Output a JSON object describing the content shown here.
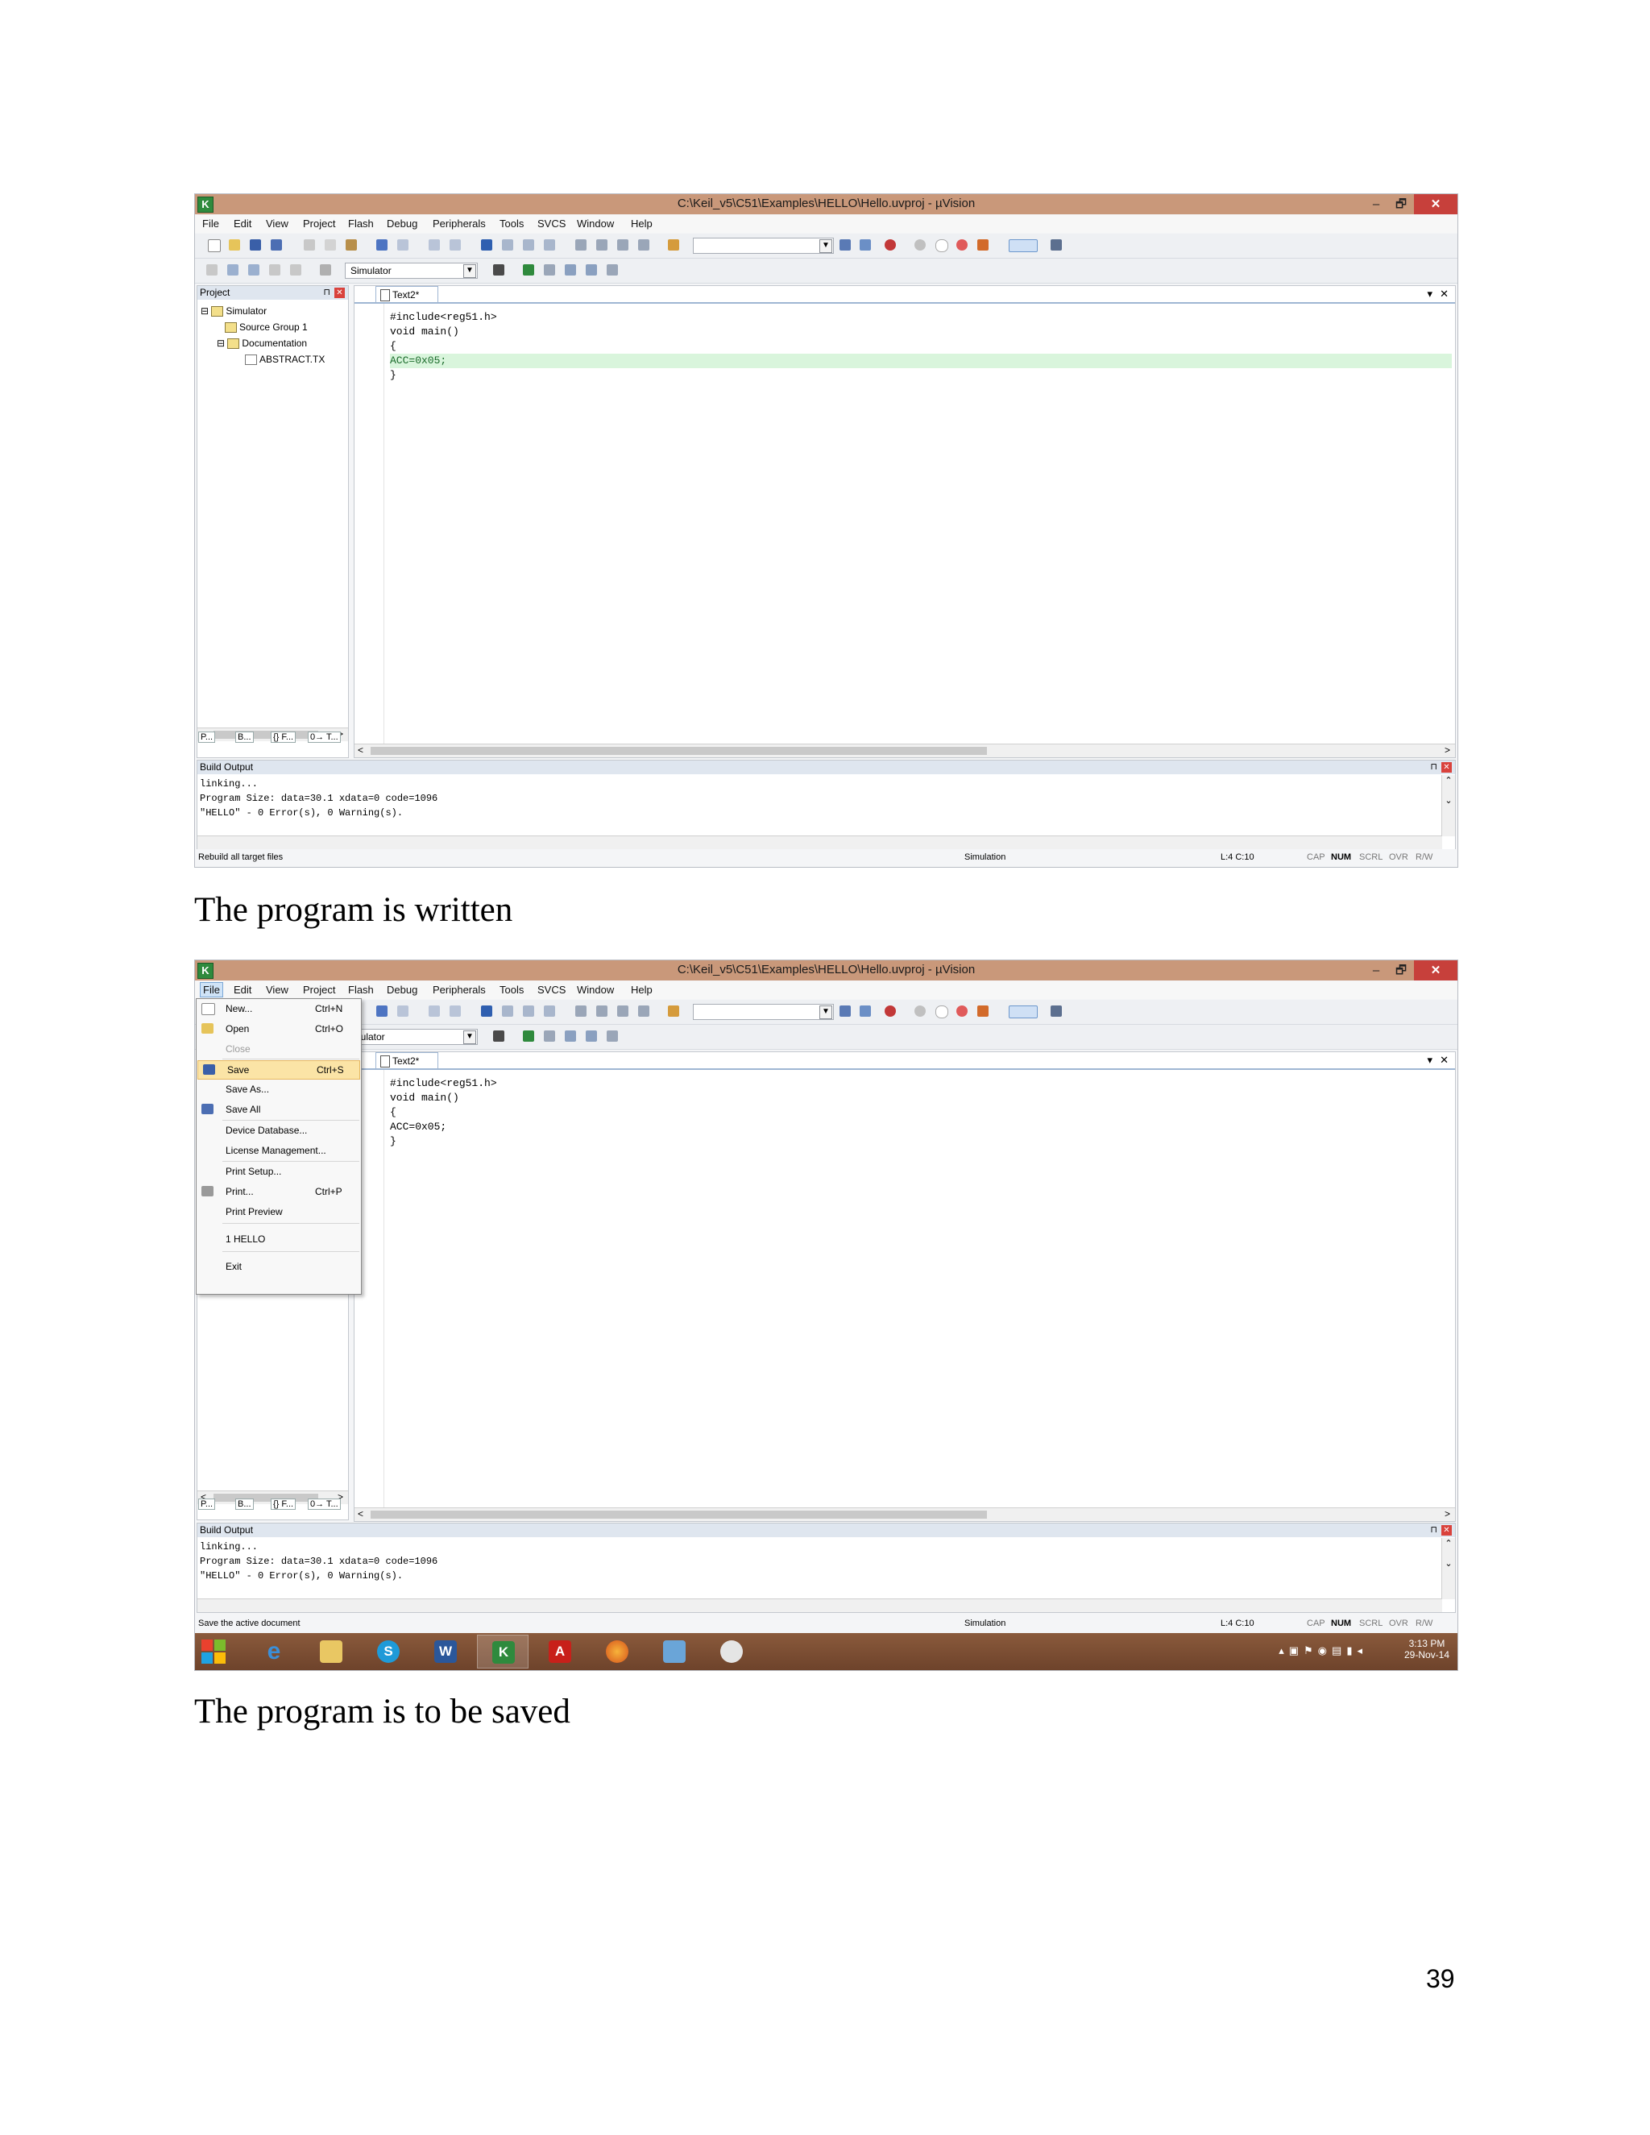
{
  "window_title": "C:\\Keil_v5\\C51\\Examples\\HELLO\\Hello.uvproj - µVision",
  "app_icon_text": "K",
  "window_controls": {
    "minimize": "–",
    "restore": "🗗",
    "close": "✕"
  },
  "menubar": [
    "File",
    "Edit",
    "View",
    "Project",
    "Flash",
    "Debug",
    "Peripherals",
    "Tools",
    "SVCS",
    "Window",
    "Help"
  ],
  "target_select": "Simulator",
  "target_select_clipped": "imulator",
  "project_panel": {
    "title": "Project",
    "tree": [
      "Simulator",
      "Source Group 1",
      "Documentation",
      "ABSTRACT.TX"
    ],
    "tabs": [
      "P...",
      "B...",
      "{} F...",
      "0→ T..."
    ]
  },
  "editor": {
    "tab": "Text2*",
    "code": [
      "#include<reg51.h>",
      "void main()",
      "{",
      "ACC=0x05;",
      "}"
    ]
  },
  "build_output": {
    "title": "Build Output",
    "lines": [
      "linking...",
      "Program Size: data=30.1 xdata=0 code=1096",
      "\"HELLO\" - 0 Error(s), 0 Warning(s)."
    ]
  },
  "statusbar": {
    "message1": "Rebuild all target files",
    "message2": "Save the active document",
    "mode": "Simulation",
    "position": "L:4 C:10",
    "keys": [
      "CAP",
      "NUM",
      "SCRL",
      "OVR",
      "R/W"
    ]
  },
  "file_menu": [
    {
      "label": "New...",
      "shortcut": "Ctrl+N"
    },
    {
      "label": "Open",
      "shortcut": "Ctrl+O"
    },
    {
      "label": "Close",
      "shortcut": ""
    },
    {
      "label": "Save",
      "shortcut": "Ctrl+S"
    },
    {
      "label": "Save As...",
      "shortcut": ""
    },
    {
      "label": "Save All",
      "shortcut": ""
    },
    {
      "label": "Device Database...",
      "shortcut": ""
    },
    {
      "label": "License Management...",
      "shortcut": ""
    },
    {
      "label": "Print Setup...",
      "shortcut": ""
    },
    {
      "label": "Print...",
      "shortcut": "Ctrl+P"
    },
    {
      "label": "Print Preview",
      "shortcut": ""
    },
    {
      "label": "1 HELLO",
      "shortcut": ""
    },
    {
      "label": "Exit",
      "shortcut": ""
    }
  ],
  "taskbar": {
    "apps": [
      "start",
      "internet-explorer",
      "file-explorer",
      "skype",
      "word",
      "keil-uvision",
      "acrobat",
      "firefox",
      "remote-desktop",
      "snipping-tool"
    ],
    "app_glyphs": {
      "ie": "e",
      "skype": "S",
      "word": "W",
      "keil": "K",
      "pdf": "A"
    },
    "time": "3:13 PM",
    "date": "29-Nov-14"
  },
  "captions": {
    "first": "The program is written",
    "second": "The program is to be saved"
  },
  "page_number": "39",
  "colors": {
    "titlebar": "#c9987a",
    "close_button": "#c7403b",
    "highlight_line": "#d9f5dc",
    "menu_highlight": "#fbe4a6",
    "taskbar": "#7a4c31"
  }
}
